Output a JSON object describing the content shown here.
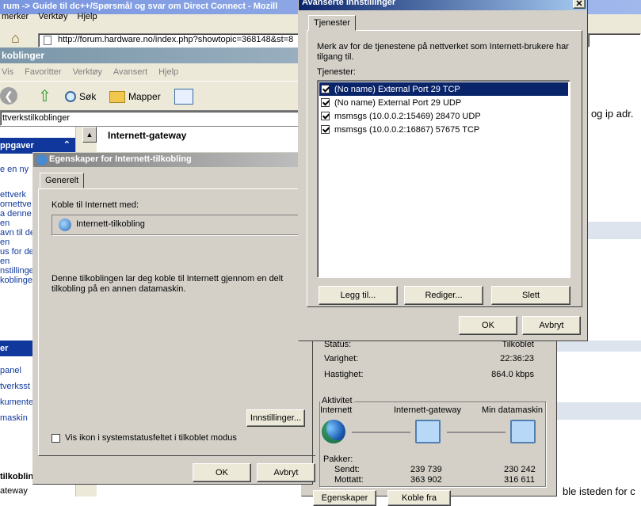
{
  "browser": {
    "title": "rum -> Guide til dc++/Spørsmål og svar om Direct Connect - Mozill",
    "menu": [
      "merker",
      "Verktøy",
      "Hjelp"
    ],
    "url": "http://forum.hardware.no/index.php?showtopic=368148&st=8"
  },
  "forum": {
    "text1": "r og ip adr.",
    "text2": "ble isteden for c"
  },
  "explorer": {
    "title": "koblinger",
    "menu": [
      "Vis",
      "Favoritter",
      "Verktøy",
      "Avansert",
      "Hjelp"
    ],
    "toolbar": {
      "search": "Søk",
      "folders": "Mapper"
    },
    "address": "ttverkstilkoblinger",
    "column_header": "Internett-gateway",
    "sidebar_head1": "ppgaver",
    "tasks": [
      "e en ny",
      "ettverk",
      "ornettve",
      "a denne",
      "en",
      "avn til de",
      "en",
      "us for de",
      "en",
      "nstillinge",
      "koblinge"
    ],
    "sidebar_head2": "er",
    "other": [
      "panel",
      "tverksst",
      "kumenter",
      "maskin"
    ],
    "bottom_head": "tilkoblin",
    "bottom_item": "ateway"
  },
  "props": {
    "title": "Egenskaper for Internett-tilkobling",
    "tab": "Generelt",
    "connect_label": "Koble til Internett med:",
    "connection": "Internett-tilkobling",
    "description": "Denne tilkoblingen lar deg koble til Internett gjennom en delt tilkobling på en annen datamaskin.",
    "settings_button": "Innstillinger...",
    "tray_checkbox": "Vis ikon i systemstatusfeltet i tilkoblet modus",
    "ok": "OK",
    "cancel": "Avbryt"
  },
  "status": {
    "status_label": "Status:",
    "status_value": "Tilkoblet",
    "duration_label": "Varighet:",
    "duration_value": "22:36:23",
    "speed_label": "Hastighet:",
    "speed_value": "864.0 kbps",
    "activity_label": "Aktivitet",
    "internet": "Internett",
    "gateway": "Internett-gateway",
    "computer": "Min datamaskin",
    "packets_label": "Pakker:",
    "sent_label": "Sendt:",
    "received_label": "Mottatt:",
    "sent_gateway": "239 739",
    "received_gateway": "363 902",
    "sent_computer": "230 242",
    "received_computer": "316 611",
    "btn1": "Egenskaper",
    "btn2": "Koble fra"
  },
  "advanced": {
    "title": "Avanserte innstillinger",
    "tab": "Tjenester",
    "description": "Merk av for de tjenestene på nettverket som Internett-brukere har tilgang til.",
    "services_label": "Tjenester:",
    "services": [
      {
        "label": "(No name) External Port 29 TCP",
        "checked": true,
        "selected": true
      },
      {
        "label": "(No name) External Port 29 UDP",
        "checked": true,
        "selected": false
      },
      {
        "label": "msmsgs (10.0.0.2:15469) 28470 UDP",
        "checked": true,
        "selected": false
      },
      {
        "label": "msmsgs (10.0.0.2:16867) 57675 TCP",
        "checked": true,
        "selected": false
      }
    ],
    "add": "Legg til...",
    "edit": "Rediger...",
    "delete": "Slett",
    "ok": "OK",
    "cancel": "Avbryt"
  }
}
